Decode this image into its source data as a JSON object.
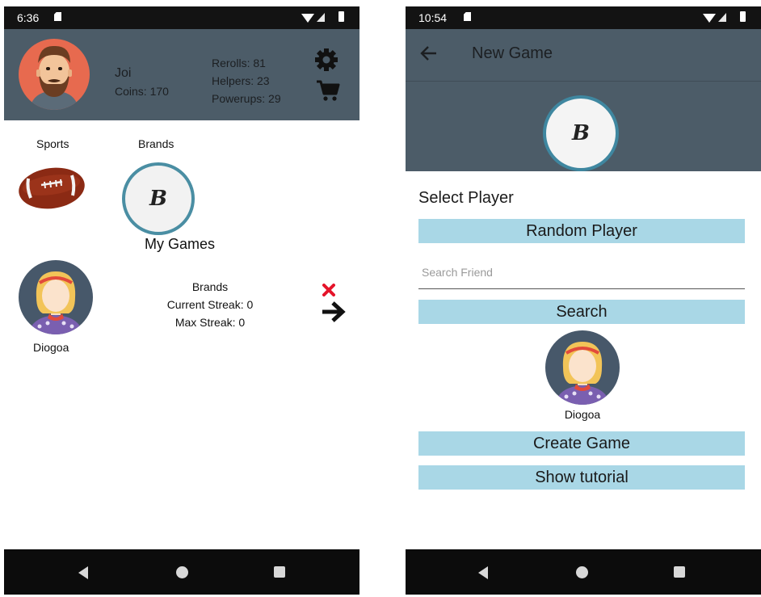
{
  "left": {
    "status": {
      "time": "6:36"
    },
    "profile": {
      "name": "Joi",
      "coins": "Coins: 170",
      "rerolls": "Rerolls: 81",
      "helpers": "Helpers: 23",
      "powerups": "Powerups: 29"
    },
    "categories": [
      {
        "label": "Sports"
      },
      {
        "label": "Brands",
        "badge": "B"
      }
    ],
    "my_games_title": "My Games",
    "game": {
      "opponent": "Diogoa",
      "category": "Brands",
      "current_streak": "Current Streak: 0",
      "max_streak": "Max Streak: 0"
    }
  },
  "right": {
    "status": {
      "time": "10:54"
    },
    "title": "New Game",
    "category_badge": "B",
    "select_player": "Select Player",
    "random_player": "Random Player",
    "search_placeholder": "Search Friend",
    "search_button": "Search",
    "player_name": "Diogoa",
    "create_game": "Create Game",
    "show_tutorial": "Show tutorial"
  },
  "colors": {
    "header": "#4c5c68",
    "button": "#a9d7e6",
    "ring": "#4a8ea3",
    "delete": "#e5142a"
  }
}
